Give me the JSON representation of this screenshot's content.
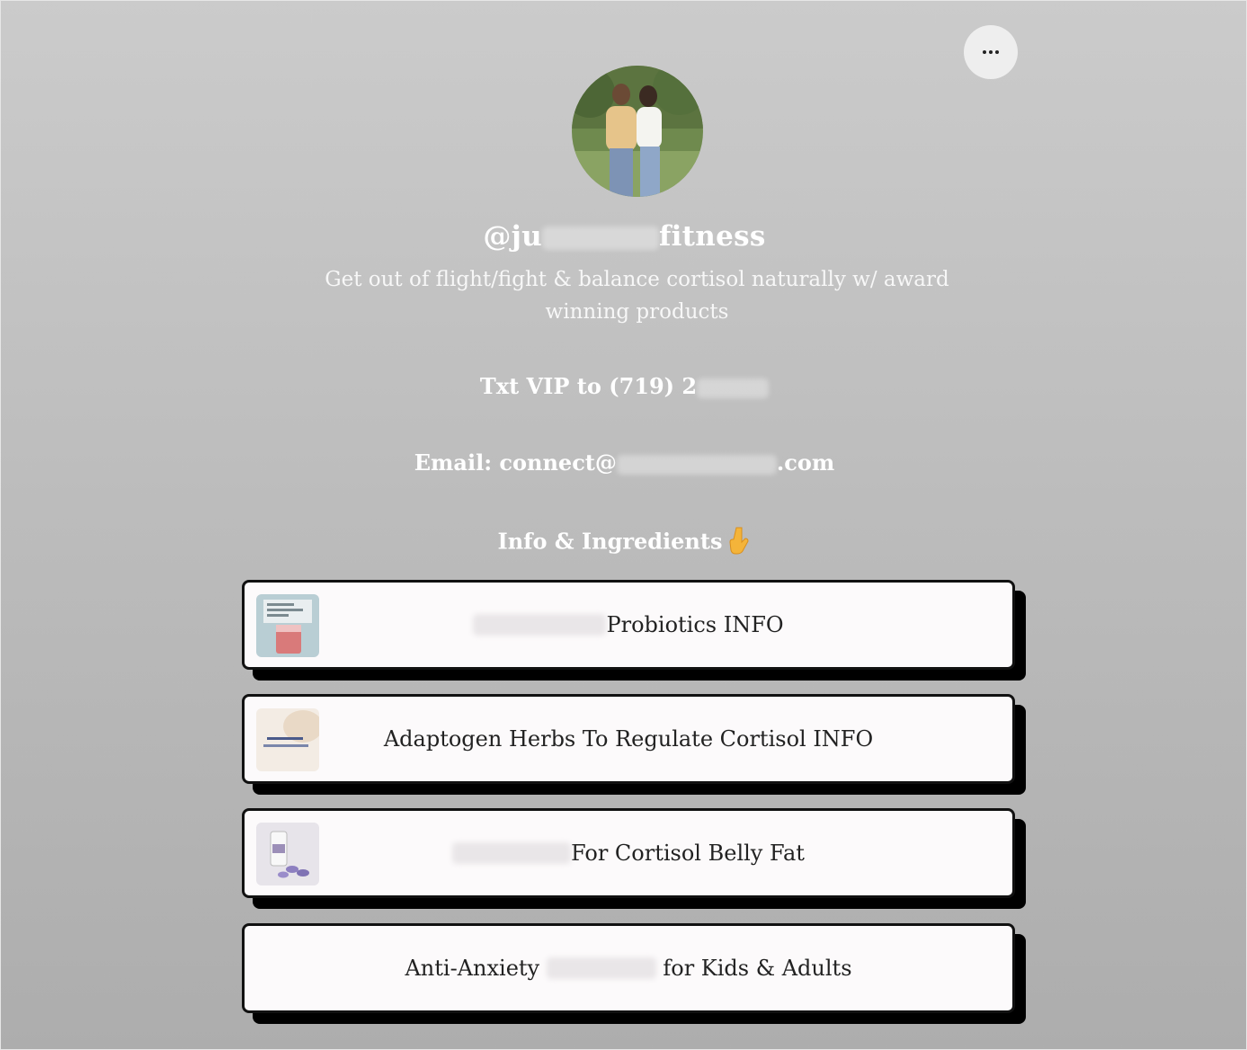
{
  "header": {
    "more_icon": "ellipsis-icon",
    "avatar_icon": "profile-photo"
  },
  "profile": {
    "username_prefix": "@ju",
    "username_suffix": "fitness",
    "bio": "Get out of flight/fight & balance cortisol naturally w/ award winning products",
    "vip_text": "Txt VIP to (719) 2",
    "email_prefix": "Email: connect@",
    "email_suffix": ".com",
    "info_heading": "Info & Ingredients",
    "info_emoji": "pointing-down-icon"
  },
  "links": [
    {
      "text": "Probiotics INFO",
      "thumb": "probiotic-drink-thumbnail"
    },
    {
      "text": "Adaptogen Herbs To Regulate Cortisol INFO",
      "thumb": "mood-support-thumbnail"
    },
    {
      "text": "For Cortisol Belly Fat",
      "thumb": "supplement-bottle-thumbnail"
    },
    {
      "text_prefix": "Anti-Anxiety",
      "text_suffix": "for Kids & Adults"
    }
  ],
  "colors": {
    "background_top": "#cbcbcb",
    "background_bottom": "#adadad",
    "card_bg": "#fcfafb",
    "card_border": "#111111",
    "card_shadow": "#000000",
    "text_light": "#ffffff",
    "text_dark": "#222222"
  }
}
